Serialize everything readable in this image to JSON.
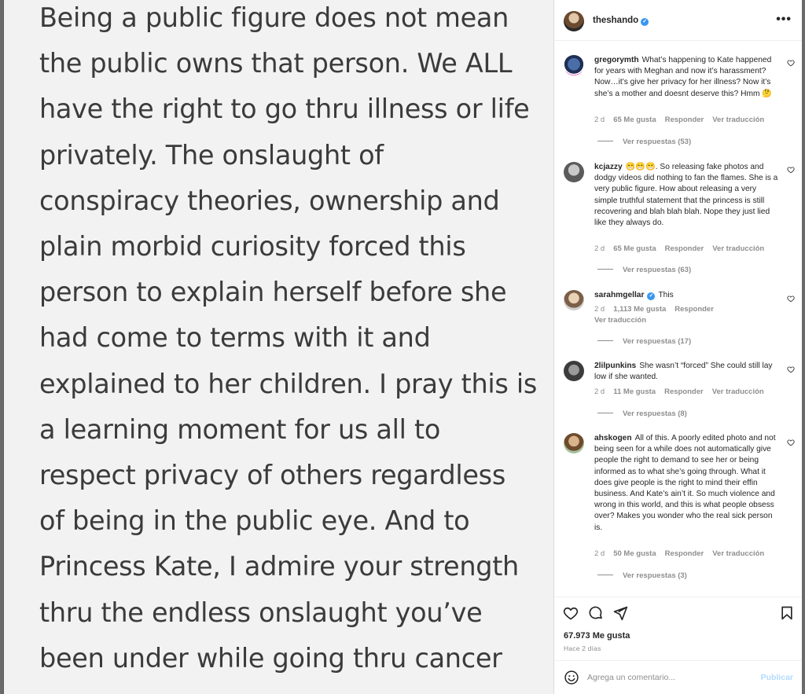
{
  "post_image": {
    "text": "Being a public figure does not mean\nthe public owns that person. We ALL\nhave the right to go thru illness or life\nprivately.  The onslaught of\nconspiracy theories, ownership and\nplain morbid curiosity forced this\nperson to explain herself before she\nhad come to terms with it and\nexplained to her children. I pray this is\na learning moment for us all to\nrespect privacy of others regardless\nof being in the public eye. And to\nPrincess Kate, I admire your strength\nthru the endless onslaught you’ve\nbeen under while going thru cancer"
  },
  "header": {
    "username": "theshando",
    "verified_mark": "✓",
    "more_icon": "more-horizontal-icon"
  },
  "comments": [
    {
      "username": "gregorymth",
      "text": "What’s happening to Kate happened for years with Meghan and now it’s harassment? Now…it’s give her privacy for her illness? Now it’s she’s a mother and doesnt deserve this? Hmm 🤔",
      "time": "2 d",
      "likes": "65 Me gusta",
      "reply": "Responder",
      "translate": "Ver traducción",
      "replies": "Ver respuestas (53)"
    },
    {
      "username": "kcjazzy",
      "text": "😁😁😁. So releasing fake photos and dodgy videos did nothing to fan the flames. She is a very public figure. How about releasing a very simple truthful statement that the princess is still recovering and blah blah blah. Nope they just lied like they always do.",
      "time": "2 d",
      "likes": "65 Me gusta",
      "reply": "Responder",
      "translate": "Ver traducción",
      "replies": "Ver respuestas (63)"
    },
    {
      "username": "sarahmgellar",
      "verified_mark": "✓",
      "text": "This",
      "time": "2 d",
      "likes": "1,113 Me gusta",
      "reply": "Responder",
      "translate": "Ver traducción",
      "replies": "Ver respuestas (17)"
    },
    {
      "username": "2lilpunkins",
      "text": "She wasn’t “forced” She could still lay low if she wanted.",
      "time": "2 d",
      "likes": "11 Me gusta",
      "reply": "Responder",
      "translate": "Ver traducción",
      "replies": "Ver respuestas (8)"
    },
    {
      "username": "ahskogen",
      "text": "All of this. A poorly edited photo and not being seen for a while does not automatically give people the right to demand to see her or being informed as to what she’s going through. What it does give people is the right to mind their effin business. And Kate’s ain’t it. So much violence and wrong in this world, and this is what people obsess over? Makes you wonder who the real sick person is.",
      "time": "2 d",
      "likes": "50 Me gusta",
      "reply": "Responder",
      "translate": "Ver traducción",
      "replies": "Ver respuestas (3)"
    }
  ],
  "actions": {
    "like_icon": "heart-icon",
    "comment_icon": "comment-icon",
    "share_icon": "share-icon",
    "save_icon": "bookmark-icon",
    "likes": "67.973 Me gusta",
    "time": "Hace 2 días"
  },
  "add_comment": {
    "emoji_icon": "emoji-icon",
    "placeholder": "Agrega un comentario...",
    "publish": "Publicar"
  }
}
